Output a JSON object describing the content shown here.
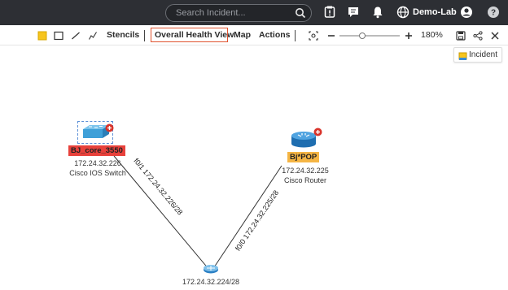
{
  "header": {
    "search_placeholder": "Search Incident...",
    "tenant": "Demo-Lab",
    "icons": [
      "search-icon",
      "alert-icon",
      "chat-icon",
      "bell-icon",
      "globe-icon",
      "user-icon",
      "help-icon"
    ]
  },
  "toolbar": {
    "stencils": "Stencils",
    "overall_health_view": "Overall Health View",
    "map": "Map",
    "actions": "Actions",
    "zoom": "180%"
  },
  "incident_tab": "Incident",
  "nodes": [
    {
      "name": "BJ_core_3550",
      "ip": "172.24.32.226",
      "type": "Cisco IOS Switch",
      "label_color": "#e8413b"
    },
    {
      "name": "Bj*POP",
      "ip": "172.24.32.225",
      "type": "Cisco Router",
      "label_color": "#f5b544"
    }
  ],
  "hub": {
    "subnet": "172.24.32.224/28"
  },
  "links": [
    {
      "label": "f0/1 172.24.32.226/28"
    },
    {
      "label": "f0/0 172.24.32.225/28"
    }
  ],
  "colors": {
    "topbar": "#2d2f34",
    "accent_box": "#e0522f",
    "switch": "#3fa0d8",
    "router": "#2a7fc4"
  }
}
